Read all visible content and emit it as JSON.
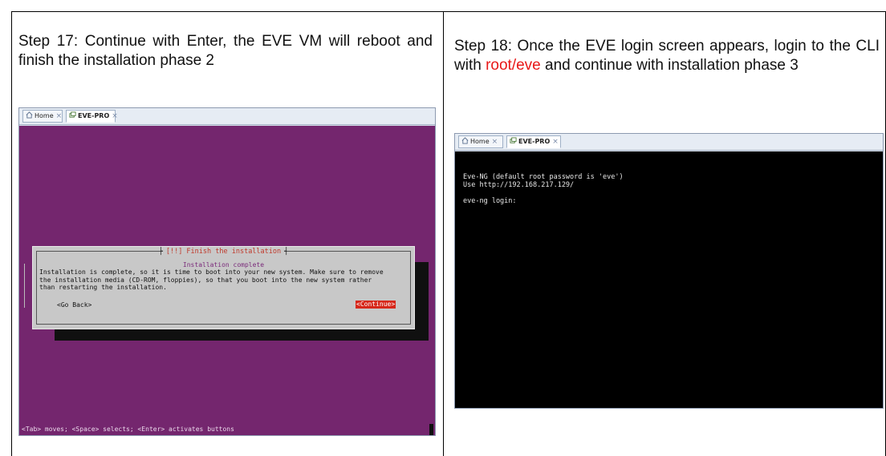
{
  "left_cell": {
    "caption": "Step 17: Continue with Enter, the EVE VM will reboot and finish the installation phase 2"
  },
  "right_cell": {
    "caption_before": "Step 18: Once the EVE login screen appears, login to the CLI with ",
    "caption_highlight": "root/eve",
    "caption_after": " and continue with installation phase 3",
    "highlight_color": "#e81818"
  },
  "vm_tabs": {
    "home_label": "Home",
    "vm_label": "EVE-PRO",
    "close_glyph": "×"
  },
  "installer": {
    "dialog_title": "[!!] Finish the installation",
    "subtitle": "Installation complete",
    "body": "Installation is complete, so it is time to boot into your new system. Make sure to remove\nthe installation media (CD-ROM, floppies), so that you boot into the new system rather\nthan restarting the installation.",
    "back_button": "<Go Back>",
    "continue_button": "<Continue>",
    "status_line": "<Tab> moves; <Space> selects; <Enter> activates buttons",
    "background_color": "#74266e"
  },
  "console": {
    "line1": "Eve-NG (default root password is 'eve')",
    "line2": "Use http://192.168.217.129/",
    "line3": "eve-ng login:"
  },
  "icons": [
    "home-icon",
    "vm-icon",
    "close-icon"
  ]
}
